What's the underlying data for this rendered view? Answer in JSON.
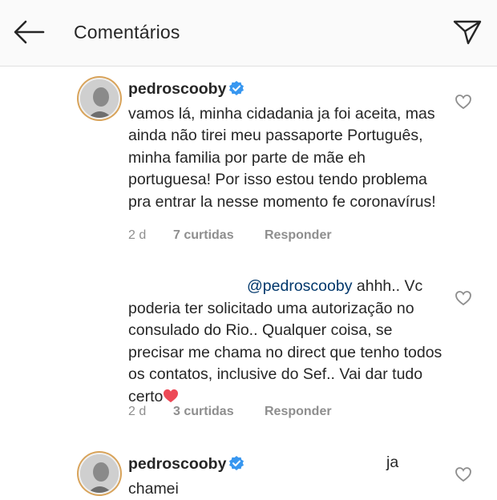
{
  "header": {
    "title": "Comentários"
  },
  "comments": [
    {
      "username": "pedroscooby",
      "text": "vamos lá, minha cidadania ja foi aceita, mas ainda não tirei meu passaporte Português, minha familia por parte de mãe eh portuguesa! Por isso estou tendo problema pra entrar la nesse momento fe coronavírus!",
      "time": "2 d",
      "likes": "7 curtidas",
      "reply": "Responder"
    },
    {
      "mention": "@pedroscooby",
      "text": " ahhh.. Vc poderia ter solicitado uma autorização no consulado do Rio.. Qualquer coisa, se precisar me chama no direct que tenho todos os contatos, inclusive do Sef.. Vai dar tudo certo",
      "emoji": "❤️",
      "time": "2 d",
      "likes": "3 curtidas",
      "reply": "Responder"
    },
    {
      "username": "pedroscooby",
      "text_ja": "ja",
      "text": "chamei"
    }
  ],
  "icons": {
    "back": "arrow-left-icon",
    "send": "paper-plane-icon",
    "like": "heart-outline-icon",
    "verified": "verified-badge-icon"
  },
  "colors": {
    "verified": "#3897f0",
    "secondary_text": "#8e8e8e",
    "mention": "#00376b",
    "heart_red": "#ed4956"
  }
}
